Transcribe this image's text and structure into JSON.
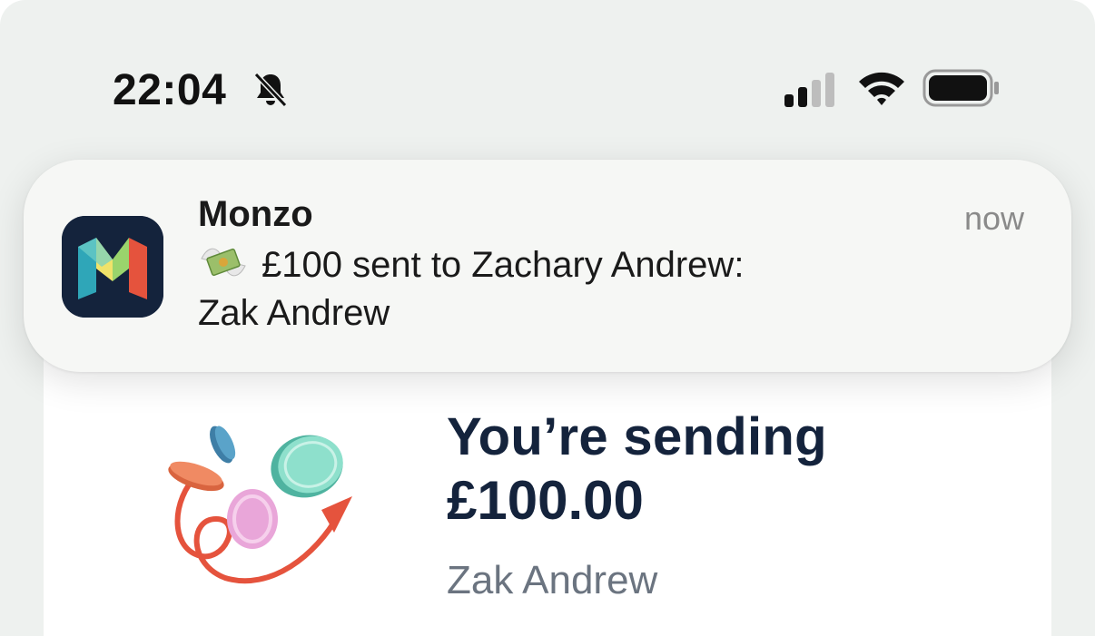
{
  "status_bar": {
    "time": "22:04",
    "bell_icon": "bell-slash-icon",
    "signal_icon": "cellular-signal-icon",
    "wifi_icon": "wifi-icon",
    "battery_icon": "battery-icon"
  },
  "notification": {
    "app_name": "Monzo",
    "time": "now",
    "emoji": "money-with-wings",
    "message_line1": "£100 sent to Zachary Andrew:",
    "message_line2": "Zak Andrew"
  },
  "transfer": {
    "title": "You’re sending",
    "amount": "£100.00",
    "recipient": "Zak Andrew"
  },
  "colors": {
    "brand_navy": "#14233c",
    "background": "#eef1ef",
    "arrow_red": "#e5533d"
  }
}
